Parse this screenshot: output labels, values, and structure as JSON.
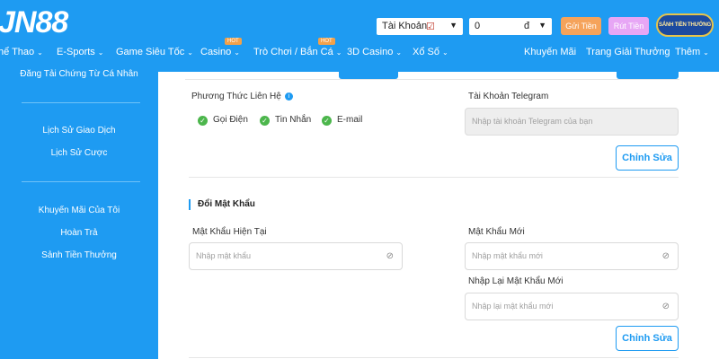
{
  "header": {
    "logo": "JN88",
    "account_select": "Tài Khoản",
    "balance_value": "0",
    "currency": "đ",
    "deposit_label": "Gửi Tiền",
    "withdraw_label": "Rút Tiền",
    "badge_label": "SẢNH TIỀN THƯỞNG"
  },
  "nav": {
    "items": [
      {
        "label": "hể Thao"
      },
      {
        "label": "E-Sports"
      },
      {
        "label": "Game Siêu Tốc"
      },
      {
        "label": "Casino",
        "hot": "HOT"
      },
      {
        "label": "Trò Chơi / Bắn Cá",
        "hot": "HOT"
      },
      {
        "label": "3D Casino"
      },
      {
        "label": "Xổ Số"
      },
      {
        "label": "Khuyến Mãi"
      },
      {
        "label": "Trang Giải Thưởng"
      },
      {
        "label": "Thêm"
      }
    ]
  },
  "sidebar": {
    "items": [
      "Đăng Tải Chứng Từ Cá Nhân",
      "Lịch Sử Giao Dịch",
      "Lịch Sử Cược",
      "Khuyến Mãi Của Tôi",
      "Hoàn Trả",
      "Sảnh Tiền Thưởng"
    ]
  },
  "contact": {
    "label": "Phương Thức Liên Hệ",
    "options": [
      "Gọi Điện",
      "Tin Nhắn",
      "E-mail"
    ],
    "telegram_label": "Tài Khoản Telegram",
    "telegram_placeholder": "Nhập tài khoản Telegram của bạn",
    "edit_label": "Chỉnh Sửa"
  },
  "password": {
    "title": "Đổi Mật Khẩu",
    "current_label": "Mật Khẩu Hiện Tại",
    "current_placeholder": "Nhập mật khẩu",
    "new_label": "Mật Khẩu Mới",
    "new_placeholder": "Nhập mật khẩu mới",
    "confirm_label": "Nhập Lại Mật Khẩu Mới",
    "confirm_placeholder": "Nhập lại mật khẩu mới",
    "edit_label": "Chỉnh Sửa"
  },
  "colors": {
    "brand_blue": "#1e9bf2",
    "check_green": "#4cb64c",
    "deposit_orange": "#f5a35b",
    "withdraw_pink": "#e7a6f5"
  }
}
